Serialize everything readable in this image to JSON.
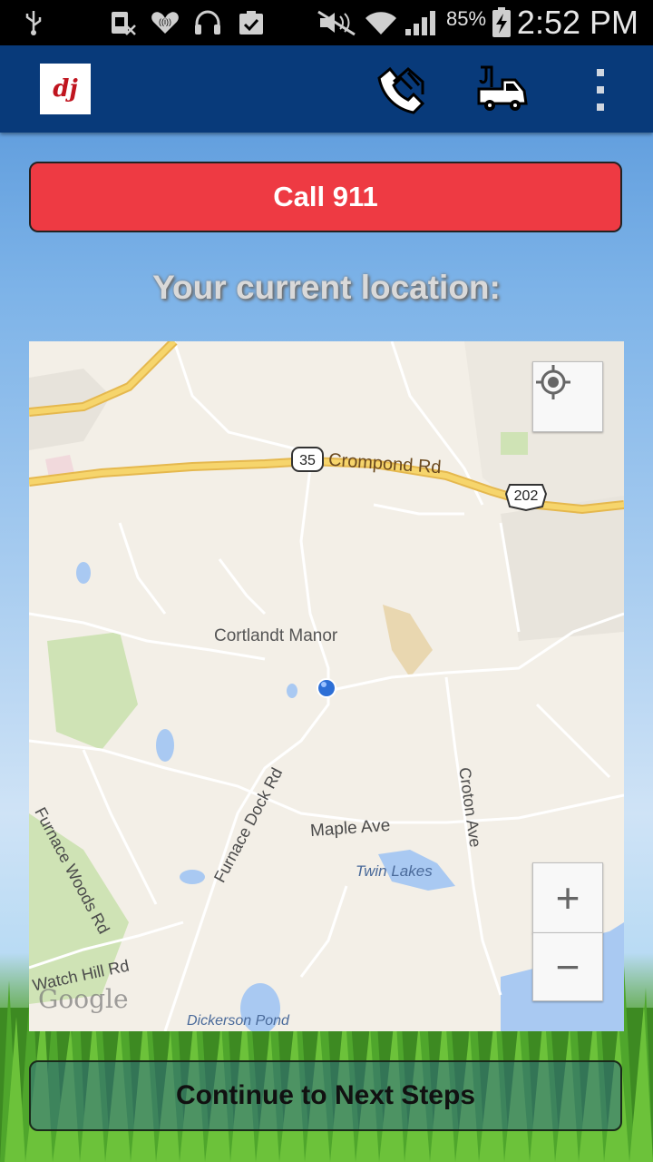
{
  "status_bar": {
    "battery": "85%",
    "time": "2:52 PM",
    "icons": [
      "usb-icon",
      "sim-off-icon",
      "iheart-icon",
      "headphones-icon",
      "clipboard-check-icon",
      "mute-icon",
      "wifi-icon",
      "signal-icon",
      "battery-charging-icon"
    ]
  },
  "app_bar": {
    "logo_text": "dj",
    "icons": [
      "phone-icon",
      "tow-truck-icon",
      "overflow-menu-icon"
    ]
  },
  "call_button": {
    "label": "Call 911",
    "color": "#ee3a43"
  },
  "location_label": "Your current location:",
  "map": {
    "labels": {
      "route_35": "35",
      "crompond": "Crompond Rd",
      "us202": "202",
      "cortlandt": "Cortlandt Manor",
      "furnace_woods": "Furnace Woods Rd",
      "furnace_dock": "Furnace Dock Rd",
      "maple": "Maple Ave",
      "croton": "Croton Ave",
      "twin_lakes": "Twin Lakes",
      "watch_hill": "Watch Hill Rd",
      "dickerson": "Dickerson Pond",
      "google": "Google"
    },
    "zoom_in": "+",
    "zoom_out": "−"
  },
  "continue_button": {
    "label": "Continue to Next Steps"
  }
}
